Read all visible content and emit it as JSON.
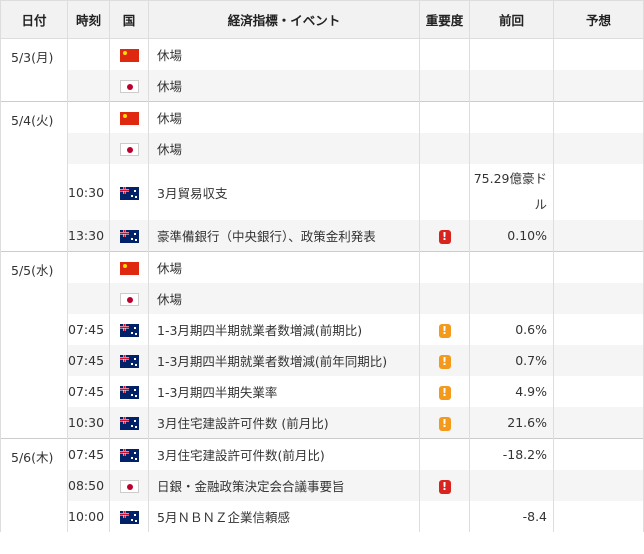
{
  "headers": {
    "date": "日付",
    "time": "時刻",
    "country": "国",
    "event": "経済指標・イベント",
    "importance": "重要度",
    "previous": "前回",
    "forecast": "予想"
  },
  "days": [
    {
      "date": "5/3(月)",
      "rows": [
        {
          "time": "",
          "flag": "china-flag",
          "event": "休場",
          "importance": "",
          "previous": "",
          "forecast": ""
        },
        {
          "time": "",
          "flag": "japan-flag",
          "event": "休場",
          "importance": "",
          "previous": "",
          "forecast": ""
        }
      ]
    },
    {
      "date": "5/4(火)",
      "rows": [
        {
          "time": "",
          "flag": "china-flag",
          "event": "休場",
          "importance": "",
          "previous": "",
          "forecast": ""
        },
        {
          "time": "",
          "flag": "japan-flag",
          "event": "休場",
          "importance": "",
          "previous": "",
          "forecast": ""
        },
        {
          "time": "10:30",
          "flag": "australia-flag",
          "event": "3月貿易収支",
          "importance": "",
          "previous": "75.29億豪ドル",
          "forecast": ""
        },
        {
          "time": "13:30",
          "flag": "australia-flag",
          "event": "豪準備銀行（中央銀行）、政策金利発表",
          "importance": "high",
          "previous": "0.10%",
          "forecast": ""
        }
      ]
    },
    {
      "date": "5/5(水)",
      "rows": [
        {
          "time": "",
          "flag": "china-flag",
          "event": "休場",
          "importance": "",
          "previous": "",
          "forecast": ""
        },
        {
          "time": "",
          "flag": "japan-flag",
          "event": "休場",
          "importance": "",
          "previous": "",
          "forecast": ""
        },
        {
          "time": "07:45",
          "flag": "australia-flag",
          "event": "1-3月期四半期就業者数増減(前期比)",
          "importance": "mid",
          "previous": "0.6%",
          "forecast": ""
        },
        {
          "time": "07:45",
          "flag": "australia-flag",
          "event": "1-3月期四半期就業者数増減(前年同期比)",
          "importance": "mid",
          "previous": "0.7%",
          "forecast": ""
        },
        {
          "time": "07:45",
          "flag": "australia-flag",
          "event": "1-3月期四半期失業率",
          "importance": "mid",
          "previous": "4.9%",
          "forecast": ""
        },
        {
          "time": "10:30",
          "flag": "australia-flag",
          "event": "3月住宅建設許可件数 (前月比)",
          "importance": "mid",
          "previous": "21.6%",
          "forecast": ""
        }
      ]
    },
    {
      "date": "5/6(木)",
      "rows": [
        {
          "time": "07:45",
          "flag": "australia-flag",
          "event": "3月住宅建設許可件数(前月比)",
          "importance": "",
          "previous": "-18.2%",
          "forecast": ""
        },
        {
          "time": "08:50",
          "flag": "japan-flag",
          "event": "日銀・金融政策決定会合議事要旨",
          "importance": "high",
          "previous": "",
          "forecast": ""
        },
        {
          "time": "10:00",
          "flag": "australia-flag",
          "event": "5月ＮＢＮＺ企業信頼感",
          "importance": "",
          "previous": "-8.4",
          "forecast": ""
        }
      ]
    }
  ],
  "importance_mark": "!",
  "colors": {
    "high": "#d9231e",
    "mid": "#f39a1d",
    "header_bg": "#f2f2f2",
    "alt_row": "#f5f5f5"
  }
}
